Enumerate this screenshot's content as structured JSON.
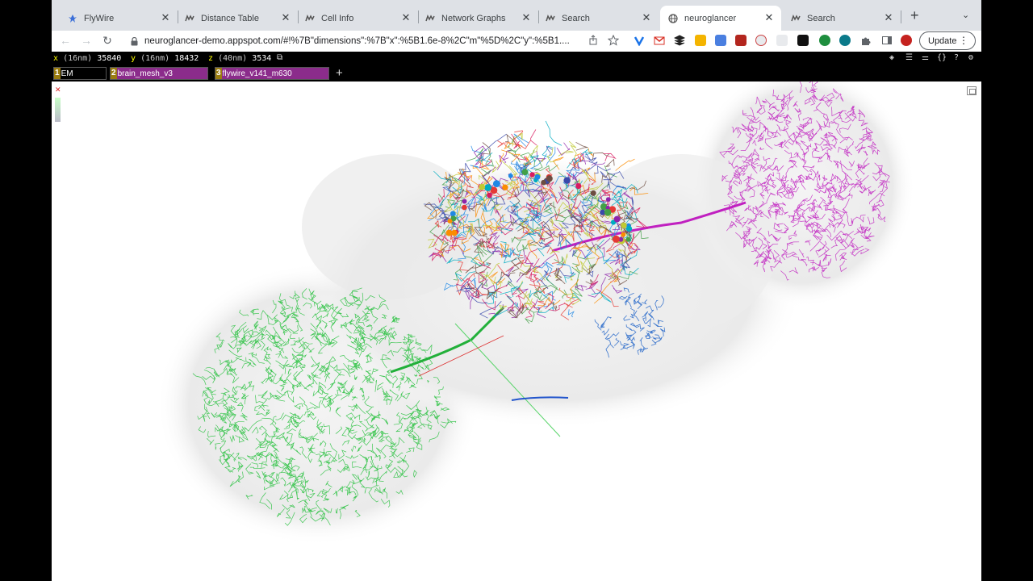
{
  "browser": {
    "tabs": [
      {
        "label": "FlyWire",
        "icon": "flywire-icon",
        "active": false
      },
      {
        "label": "Distance Table",
        "icon": "codex-icon",
        "active": false
      },
      {
        "label": "Cell Info",
        "icon": "codex-icon",
        "active": false
      },
      {
        "label": "Network Graphs",
        "icon": "codex-icon",
        "active": false
      },
      {
        "label": "Search",
        "icon": "codex-icon",
        "active": false
      },
      {
        "label": "neuroglancer",
        "icon": "globe-icon",
        "active": true
      },
      {
        "label": "Search",
        "icon": "codex-icon",
        "active": false
      }
    ],
    "url": "neuroglancer-demo.appspot.com/#!%7B\"dimensions\":%7B\"x\":%5B1.6e-8%2C\"m\"%5D%2C\"y\":%5B1....",
    "update_label": "Update"
  },
  "neuroglancer": {
    "coords": [
      {
        "axis": "x",
        "unit": "(16nm)",
        "value": "35840"
      },
      {
        "axis": "y",
        "unit": "(16nm)",
        "value": "18432"
      },
      {
        "axis": "z",
        "unit": "(40nm)",
        "value": "3534"
      }
    ],
    "layers": [
      {
        "num": "1",
        "name": "EM",
        "color": "#000000"
      },
      {
        "num": "2",
        "name": "brain_mesh_v3",
        "color": "#8b2c8b"
      },
      {
        "num": "3",
        "name": "flywire_v141_m630",
        "color": "#8b2c8b"
      }
    ],
    "colors": {
      "green_neurons": "#22c03a",
      "magenta_neurons": "#c020c0",
      "brain_mesh": "#e6e6e6"
    }
  }
}
